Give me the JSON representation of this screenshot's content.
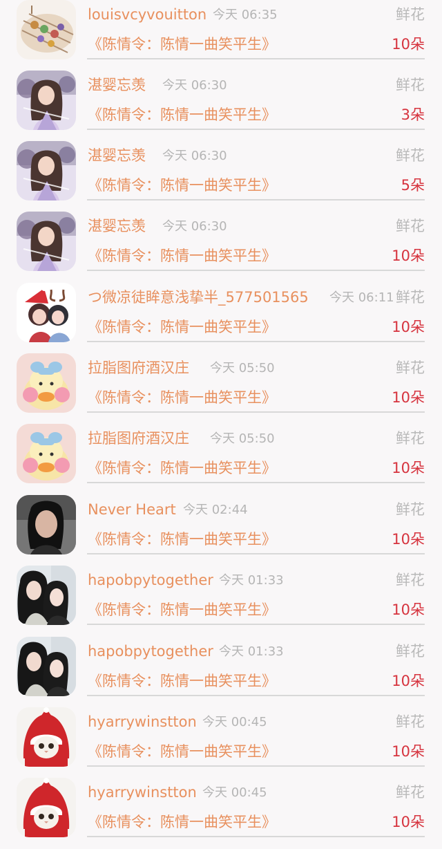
{
  "records": [
    {
      "name": "louisvcyvouitton",
      "time": "今天 06:35",
      "gift": "鲜花",
      "book": "《陈情令：陈情一曲笑平生》",
      "count": "10朵",
      "avatar": "food-plate-avatar"
    },
    {
      "name": "湛婴忘羡",
      "time": "今天 06:30",
      "gift": "鲜花",
      "book": "《陈情令：陈情一曲笑平生》",
      "count": "3朵",
      "avatar": "anime-girl-avatar"
    },
    {
      "name": "湛婴忘羡",
      "time": "今天 06:30",
      "gift": "鲜花",
      "book": "《陈情令：陈情一曲笑平生》",
      "count": "5朵",
      "avatar": "anime-girl-avatar"
    },
    {
      "name": "湛婴忘羡",
      "time": "今天 06:30",
      "gift": "鲜花",
      "book": "《陈情令：陈情一曲笑平生》",
      "count": "10朵",
      "avatar": "anime-girl-avatar"
    },
    {
      "name": "つ微凉徒眸意浅挚半_577501565",
      "time": "今天 06:11",
      "gift": "鲜花",
      "book": "《陈情令：陈情一曲笑平生》",
      "count": "10朵",
      "avatar": "christmas-anime-avatar"
    },
    {
      "name": "拉脂图府酒汉庄",
      "time": "今天 05:50",
      "gift": "鲜花",
      "book": "《陈情令：陈情一曲笑平生》",
      "count": "10朵",
      "avatar": "yellow-duck-avatar"
    },
    {
      "name": "拉脂图府酒汉庄",
      "time": "今天 05:50",
      "gift": "鲜花",
      "book": "《陈情令：陈情一曲笑平生》",
      "count": "10朵",
      "avatar": "yellow-duck-avatar"
    },
    {
      "name": "Never Heart",
      "time": "今天 02:44",
      "gift": "鲜花",
      "book": "《陈情令：陈情一曲笑平生》",
      "count": "10朵",
      "avatar": "woman-photo-avatar"
    },
    {
      "name": "hapobpytogether",
      "time": "今天 01:33",
      "gift": "鲜花",
      "book": "《陈情令：陈情一曲笑平生》",
      "count": "10朵",
      "avatar": "two-girls-photo-avatar"
    },
    {
      "name": "hapobpytogether",
      "time": "今天 01:33",
      "gift": "鲜花",
      "book": "《陈情令：陈情一曲笑平生》",
      "count": "10朵",
      "avatar": "two-girls-photo-avatar"
    },
    {
      "name": "hyarrywinstton",
      "time": "今天 00:45",
      "gift": "鲜花",
      "book": "《陈情令：陈情一曲笑平生》",
      "count": "10朵",
      "avatar": "cat-red-hood-avatar"
    },
    {
      "name": "hyarrywinstton",
      "time": "今天 00:45",
      "gift": "鲜花",
      "book": "《陈情令：陈情一曲笑平生》",
      "count": "10朵",
      "avatar": "cat-red-hood-avatar"
    }
  ],
  "colors": {
    "name": "#e8905e",
    "time": "#b5b5b5",
    "gift": "#b9b9b9",
    "count": "#d6333e",
    "divider": "#d8d8d8",
    "background": "#f9f7f8"
  }
}
